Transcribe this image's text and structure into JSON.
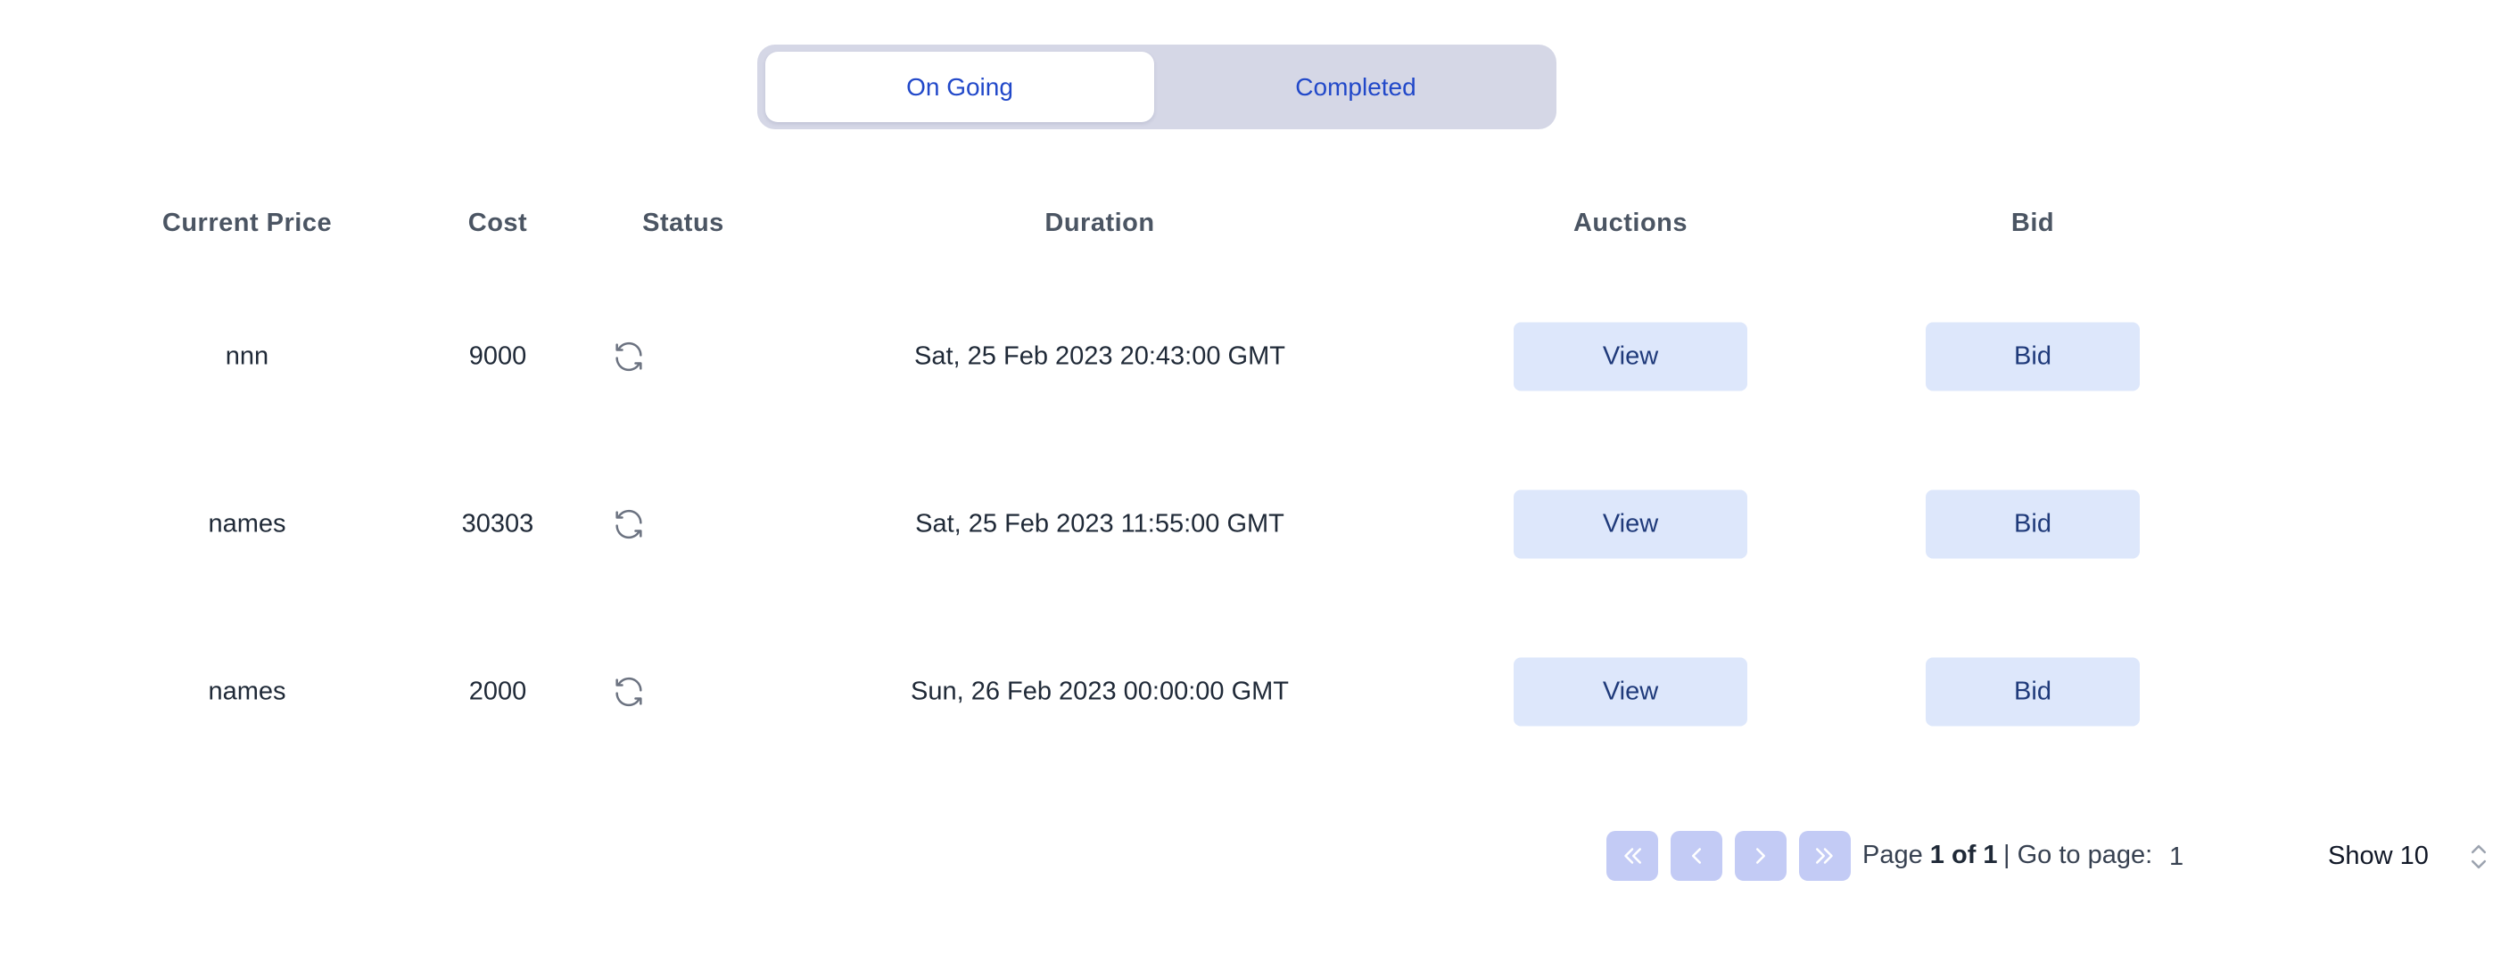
{
  "tabs": [
    {
      "label": "On Going",
      "active": true
    },
    {
      "label": "Completed",
      "active": false
    }
  ],
  "table": {
    "headers": [
      "Current Price",
      "Cost",
      "Status",
      "Duration",
      "Auctions",
      "Bid"
    ],
    "rows": [
      {
        "current_price": "nnn",
        "cost": "9000",
        "status_icon": "refresh-icon",
        "duration": "Sat, 25 Feb 2023 20:43:00 GMT",
        "auctions_label": "View",
        "bid_label": "Bid"
      },
      {
        "current_price": "names",
        "cost": "30303",
        "status_icon": "refresh-icon",
        "duration": "Sat, 25 Feb 2023 11:55:00 GMT",
        "auctions_label": "View",
        "bid_label": "Bid"
      },
      {
        "current_price": "names",
        "cost": "2000",
        "status_icon": "refresh-icon",
        "duration": "Sun, 26 Feb 2023 00:00:00 GMT",
        "auctions_label": "View",
        "bid_label": "Bid"
      }
    ]
  },
  "pagination": {
    "first_icon": "double-chevron-left-icon",
    "prev_icon": "chevron-left-icon",
    "next_icon": "chevron-right-icon",
    "last_icon": "double-chevron-right-icon",
    "page_label": "Page",
    "page_value": "1 of 1",
    "goto_label": "| Go to page:",
    "goto_value": "1",
    "show_label": "Show 10"
  },
  "colors": {
    "accent_text": "#2148c9",
    "tab_track": "#d5d7e6",
    "button_bg": "#dde7fb",
    "button_text": "#1f3a7a",
    "pager_bg": "#c3cbf5"
  }
}
